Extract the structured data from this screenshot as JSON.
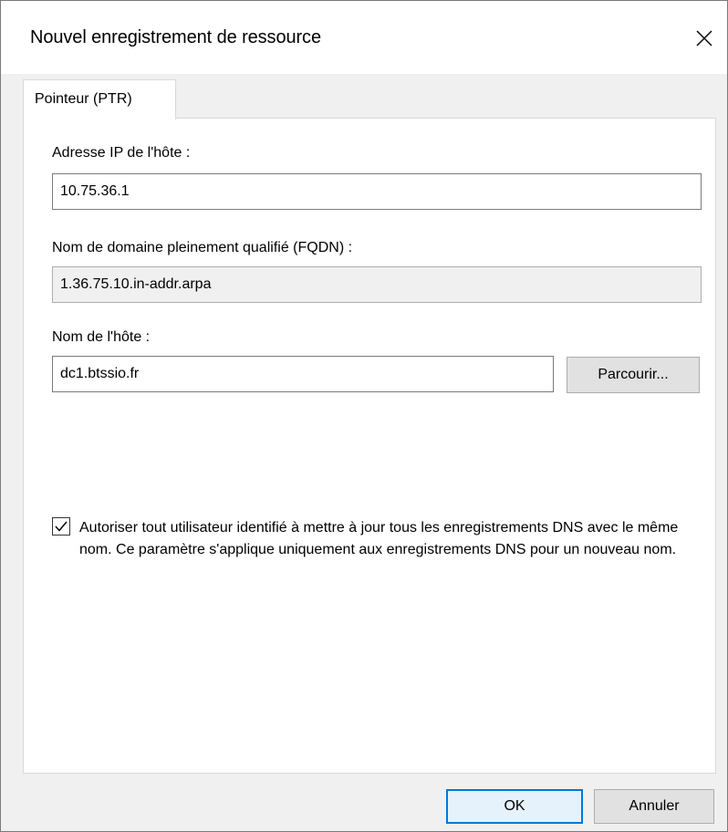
{
  "window": {
    "title": "Nouvel enregistrement de ressource",
    "close_icon": "close-icon"
  },
  "tabs": [
    {
      "label": "Pointeur (PTR)",
      "selected": true
    }
  ],
  "form": {
    "ip_label": "Adresse IP de l'hôte :",
    "ip_value": "10.75.36.1",
    "fqdn_label": "Nom de domaine pleinement qualifié (FQDN) :",
    "fqdn_value": "1.36.75.10.in-addr.arpa",
    "host_label": "Nom de l'hôte :",
    "host_value": "dc1.btssio.fr",
    "browse_label": "Parcourir...",
    "allow_update_checked": true,
    "allow_update_text": "Autoriser tout utilisateur identifié à mettre à jour tous les enregistrements DNS avec le même nom. Ce paramètre s'applique uniquement aux enregistrements DNS pour un nouveau nom."
  },
  "buttons": {
    "ok_label": "OK",
    "cancel_label": "Annuler"
  },
  "colors": {
    "accent": "#0078d7",
    "dialog_bg": "#f0f0f0",
    "button_bg": "#e1e1e1"
  }
}
